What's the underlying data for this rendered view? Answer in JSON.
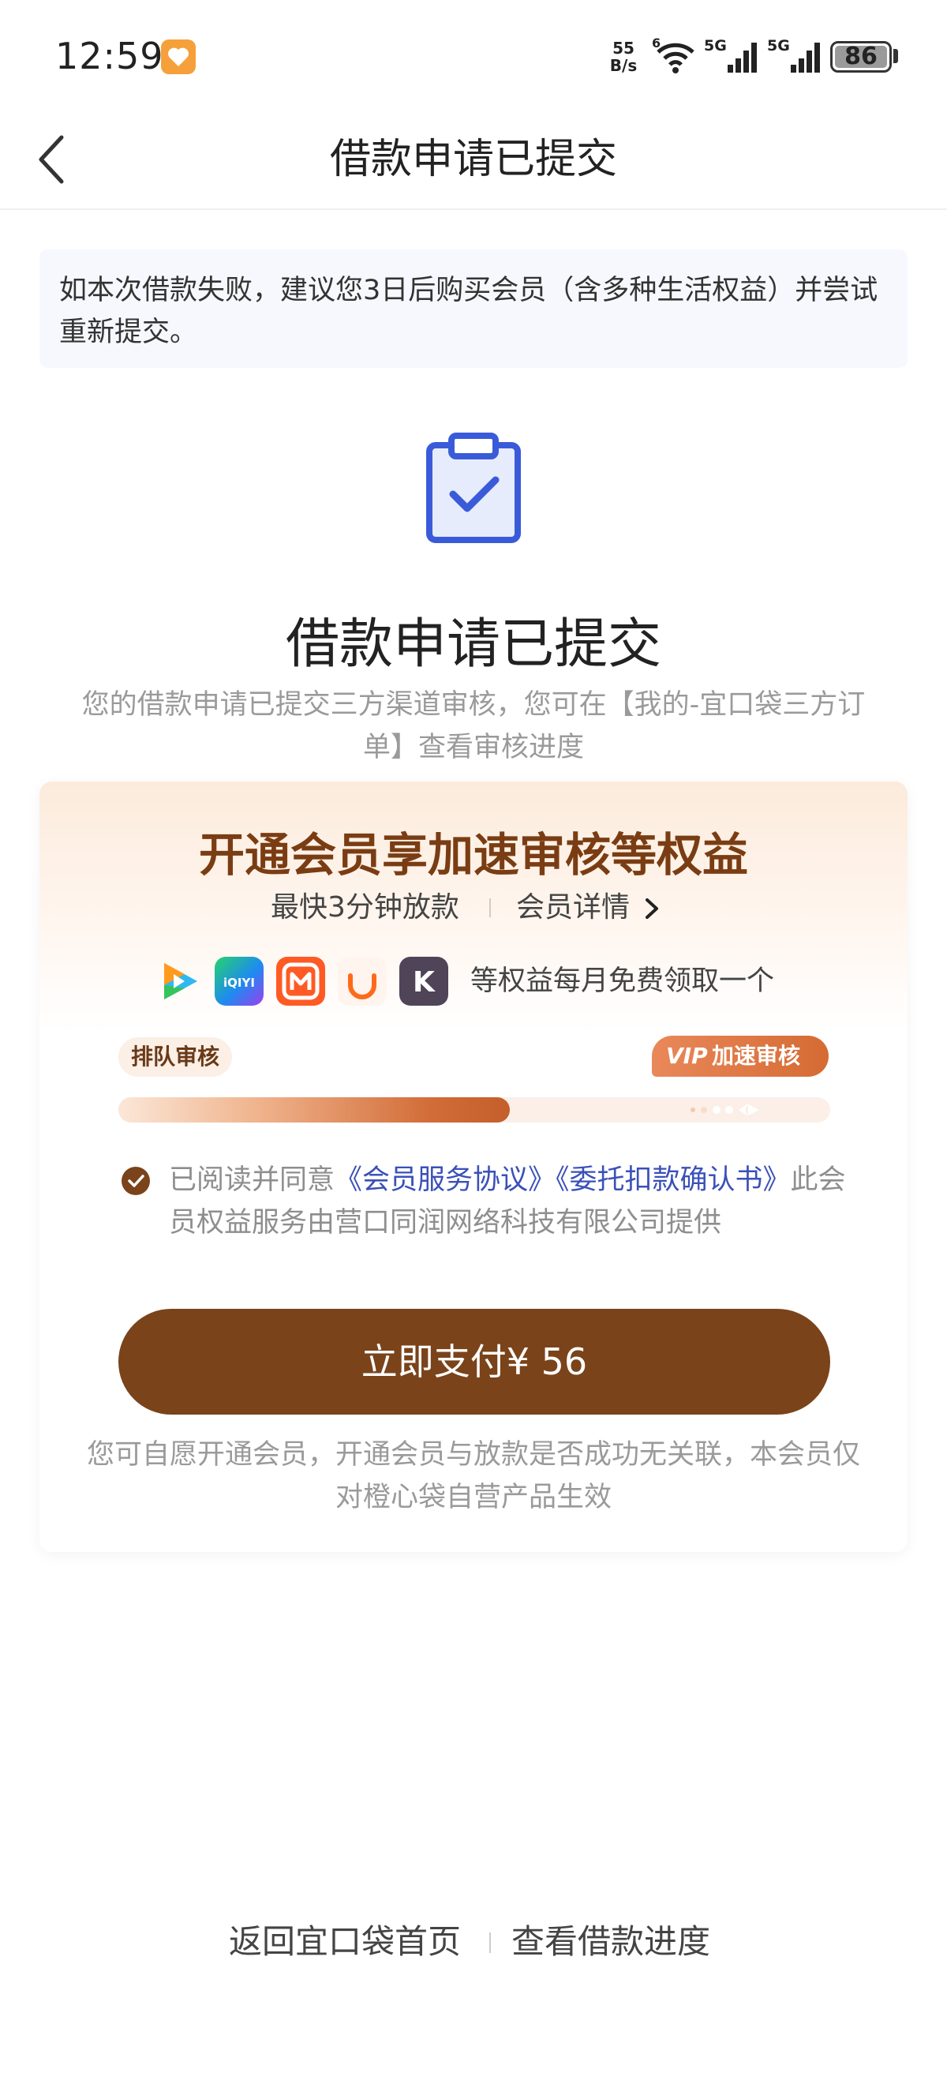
{
  "status_bar": {
    "time": "12:59",
    "net_speed_value": "55",
    "net_speed_unit": "B/s",
    "network_1": "5G",
    "network_2": "5G",
    "wifi_label": "6",
    "battery": "86"
  },
  "header": {
    "title": "借款申请已提交"
  },
  "notice": {
    "text": "如本次借款失败，建议您3日后购买会员（含多种生活权益）并尝试重新提交。"
  },
  "result": {
    "title": "借款申请已提交",
    "description": "您的借款申请已提交三方渠道审核，您可在【我的-宜口袋三方订单】查看审核进度"
  },
  "vip_card": {
    "title": "开通会员享加速审核等权益",
    "subtitle": "最快3分钟放款",
    "detail_link": "会员详情",
    "apps": [
      {
        "name": "tencent-video-icon",
        "label": ""
      },
      {
        "name": "iqiyi-icon",
        "label": "iQIYI"
      },
      {
        "name": "mango-tv-icon",
        "label": ""
      },
      {
        "name": "didi-icon",
        "label": ""
      },
      {
        "name": "keep-icon",
        "label": "K"
      }
    ],
    "apps_text": "等权益每月免费领取一个",
    "queue_tag": "排队审核",
    "vip_tag_logo": "VIP",
    "vip_tag_label": "加速审核",
    "progress_fraction": 0.55,
    "agreement": {
      "prefix": "已阅读并同意",
      "link_1": "《会员服务协议》",
      "link_2": "《委托扣款确认书》",
      "suffix": "此会员权益服务由营口同润网络科技有限公司提供",
      "checked": true
    },
    "pay_button": "立即支付¥ 56",
    "disclaimer": "您可自愿开通会员，开通会员与放款是否成功无关联，本会员仅对橙心袋自营产品生效"
  },
  "footer": {
    "home_link": "返回宜口袋首页",
    "progress_link": "查看借款进度"
  },
  "colors": {
    "brand_brown": "#7a431a",
    "title_brown": "#7a3d13",
    "link_blue": "#3b50b8",
    "icon_blue": "#3a5bd9"
  }
}
